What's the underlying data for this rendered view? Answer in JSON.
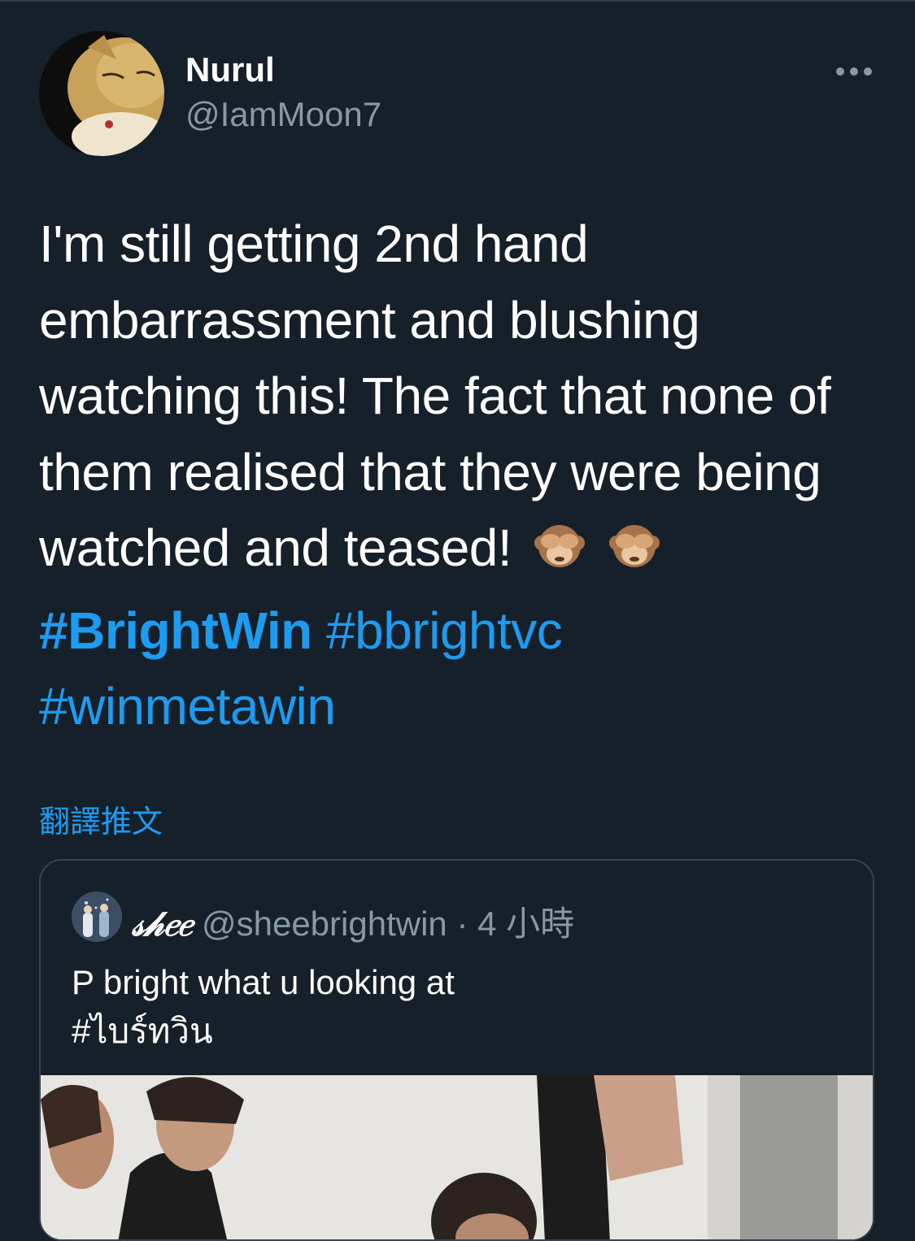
{
  "author": {
    "display_name": "Nurul",
    "handle": "@IamMoon7"
  },
  "tweet": {
    "lines": [
      "I'm still getting 2nd hand",
      "embarrassment and blushing",
      "watching this! The fact that none of",
      "them realised that they were being",
      "watched and teased!"
    ],
    "emoji": [
      "see-no-evil-monkey-emoji",
      "see-no-evil-monkey-emoji"
    ],
    "hashtags": [
      "#BrightWin",
      "#bbrightvc",
      "#winmetawin"
    ]
  },
  "translate_label": "翻譯推文",
  "quote": {
    "display_name": "𝓈𝒽𝑒𝑒",
    "handle": "@sheebrightwin",
    "separator": "·",
    "time": "4 小時",
    "text_line1": "P bright what u looking at",
    "text_line2": "#ไบร์ทวิน"
  },
  "colors": {
    "background": "#15202b",
    "link": "#1d9bf0",
    "secondary_text": "#8899a6",
    "border": "#38444d"
  }
}
